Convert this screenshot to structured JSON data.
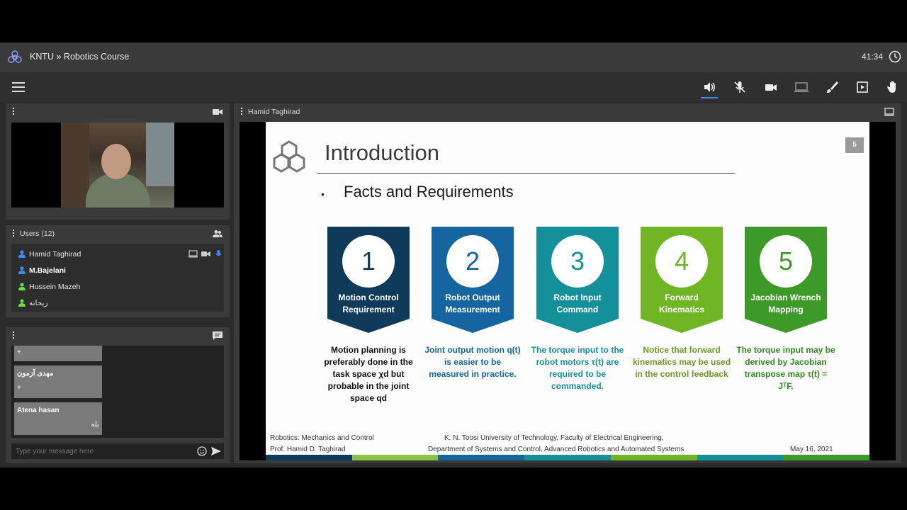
{
  "app": {
    "title": "KNTU » Robotics Course",
    "time": "41:34"
  },
  "toolbar": {
    "icons": [
      "speaker-icon",
      "mic-muted-icon",
      "camera-icon",
      "screen-share-icon",
      "brush-icon",
      "presentation-icon",
      "hand-icon"
    ],
    "active_color": "#3b8cff"
  },
  "users_panel": {
    "title": "Users (12)",
    "users": [
      {
        "name": "Hamid Taghirad",
        "color": "#3b8cff",
        "bold": false
      },
      {
        "name": "M.Bajelani",
        "color": "#3b8cff",
        "bold": true
      },
      {
        "name": "Hussein Mazeh",
        "color": "#6ddb4a",
        "bold": false
      },
      {
        "name": "ریحانه",
        "color": "#6ddb4a",
        "bold": false
      }
    ]
  },
  "chat": {
    "messages": [
      {
        "author": "",
        "text": "+"
      },
      {
        "author": "مهدی آزمون",
        "text": "+"
      },
      {
        "author": "Atena hasan",
        "text": "بله"
      }
    ],
    "placeholder": "Type your message here"
  },
  "presentation": {
    "presenter": "Hamid Taghirad",
    "slide": {
      "number": "5",
      "title": "Introduction",
      "bullet": "Facts and Requirements",
      "cards": [
        {
          "num": "1",
          "label": "Motion Control Requirement",
          "color": "#103a5a",
          "numcolor": "#103a5a",
          "desc": "Motion planning is preferably done in the task space χd but probable in the joint space qd",
          "desccolor": "#111111"
        },
        {
          "num": "2",
          "label": "Robot Output Measurement",
          "color": "#1565a0",
          "numcolor": "#1565a0",
          "desc": "Joint output motion q(t) is easier to be measured in practice.",
          "desccolor": "#1565a0"
        },
        {
          "num": "3",
          "label": "Robot Input Command",
          "color": "#13909a",
          "numcolor": "#13909a",
          "desc": "The torque input to the robot motors τ(t) are required to be commanded.",
          "desccolor": "#13909a"
        },
        {
          "num": "4",
          "label": "Forward Kinematics",
          "color": "#6fb524",
          "numcolor": "#6fb524",
          "desc": "Notice that forward kinematics may be used in the control feedback",
          "desccolor": "#6a9a22"
        },
        {
          "num": "5",
          "label": "Jacobian Wrench Mapping",
          "color": "#3d9a28",
          "numcolor": "#3d9a28",
          "desc": "The torque input may be derived by Jacobian transpose map τ(t) = JᵀF.",
          "desccolor": "#2f8a22"
        }
      ],
      "footer": {
        "left1": "Robotics: Mechanics and Control",
        "left2": "Prof. Hamid D. Taghirad",
        "center1": "K. N. Toosi University of Technology, Faculty of Electrical Engineering,",
        "center2": "Department of Systems and Control, Advanced Robotics and Automated Systems",
        "date": "May 16, 2021",
        "bar_colors": [
          "#0e3a5a",
          "#8bc53f",
          "#1565a0",
          "#13909a",
          "#6fb524",
          "#13909a",
          "#3d9a28"
        ]
      }
    }
  }
}
